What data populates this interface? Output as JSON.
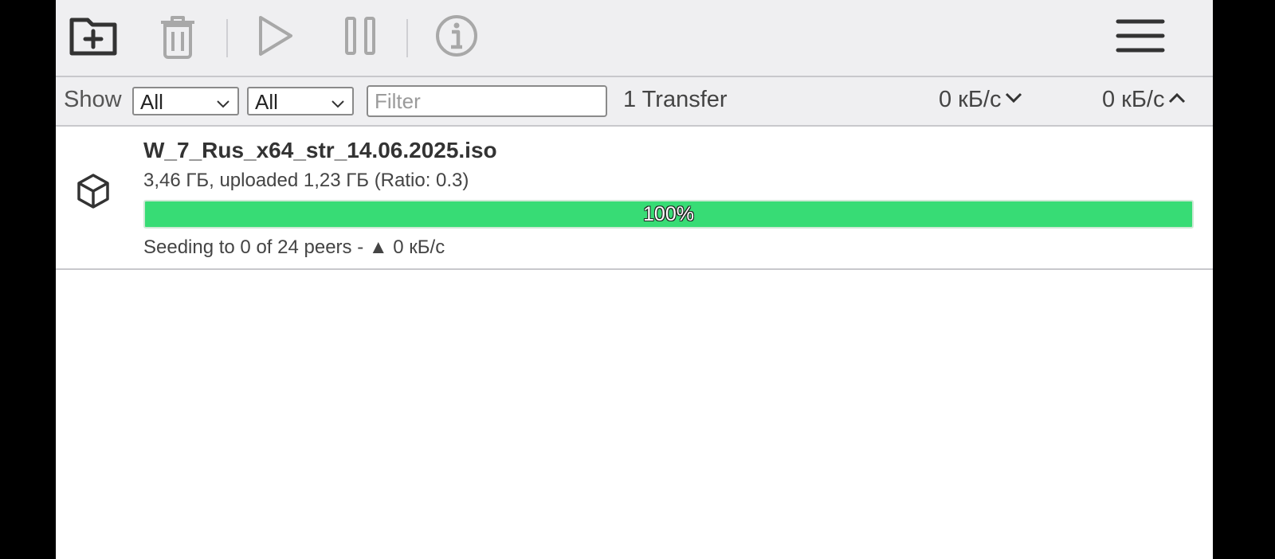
{
  "colors": {
    "toolbar_bg": "#efeff1",
    "progress_green": "#37dc75",
    "icon_dark": "#333333",
    "icon_disabled": "#a8a8a8"
  },
  "toolbar": {
    "buttons": [
      {
        "icon": "folder-plus-icon",
        "enabled": true
      },
      {
        "icon": "trash-icon",
        "enabled": false
      },
      {
        "icon": "play-icon",
        "enabled": false
      },
      {
        "icon": "pause-icon",
        "enabled": false
      },
      {
        "icon": "info-icon",
        "enabled": false
      },
      {
        "icon": "hamburger-menu-icon",
        "enabled": true
      }
    ]
  },
  "filterbar": {
    "show_label": "Show",
    "status_select": "All",
    "tracker_select": "All",
    "filter_placeholder": "Filter",
    "transfer_count": "1 Transfer",
    "download_speed": "0 кБ/с",
    "upload_speed": "0 кБ/с"
  },
  "torrents": [
    {
      "name": "W_7_Rus_x64_str_14.06.2025.iso",
      "size_info": "3,46 ГБ, uploaded 1,23 ГБ (Ratio: 0.3)",
      "progress_percent": 100,
      "progress_label": "100%",
      "peers_info": "Seeding to 0 of 24 peers - ▲ 0 кБ/с"
    }
  ]
}
